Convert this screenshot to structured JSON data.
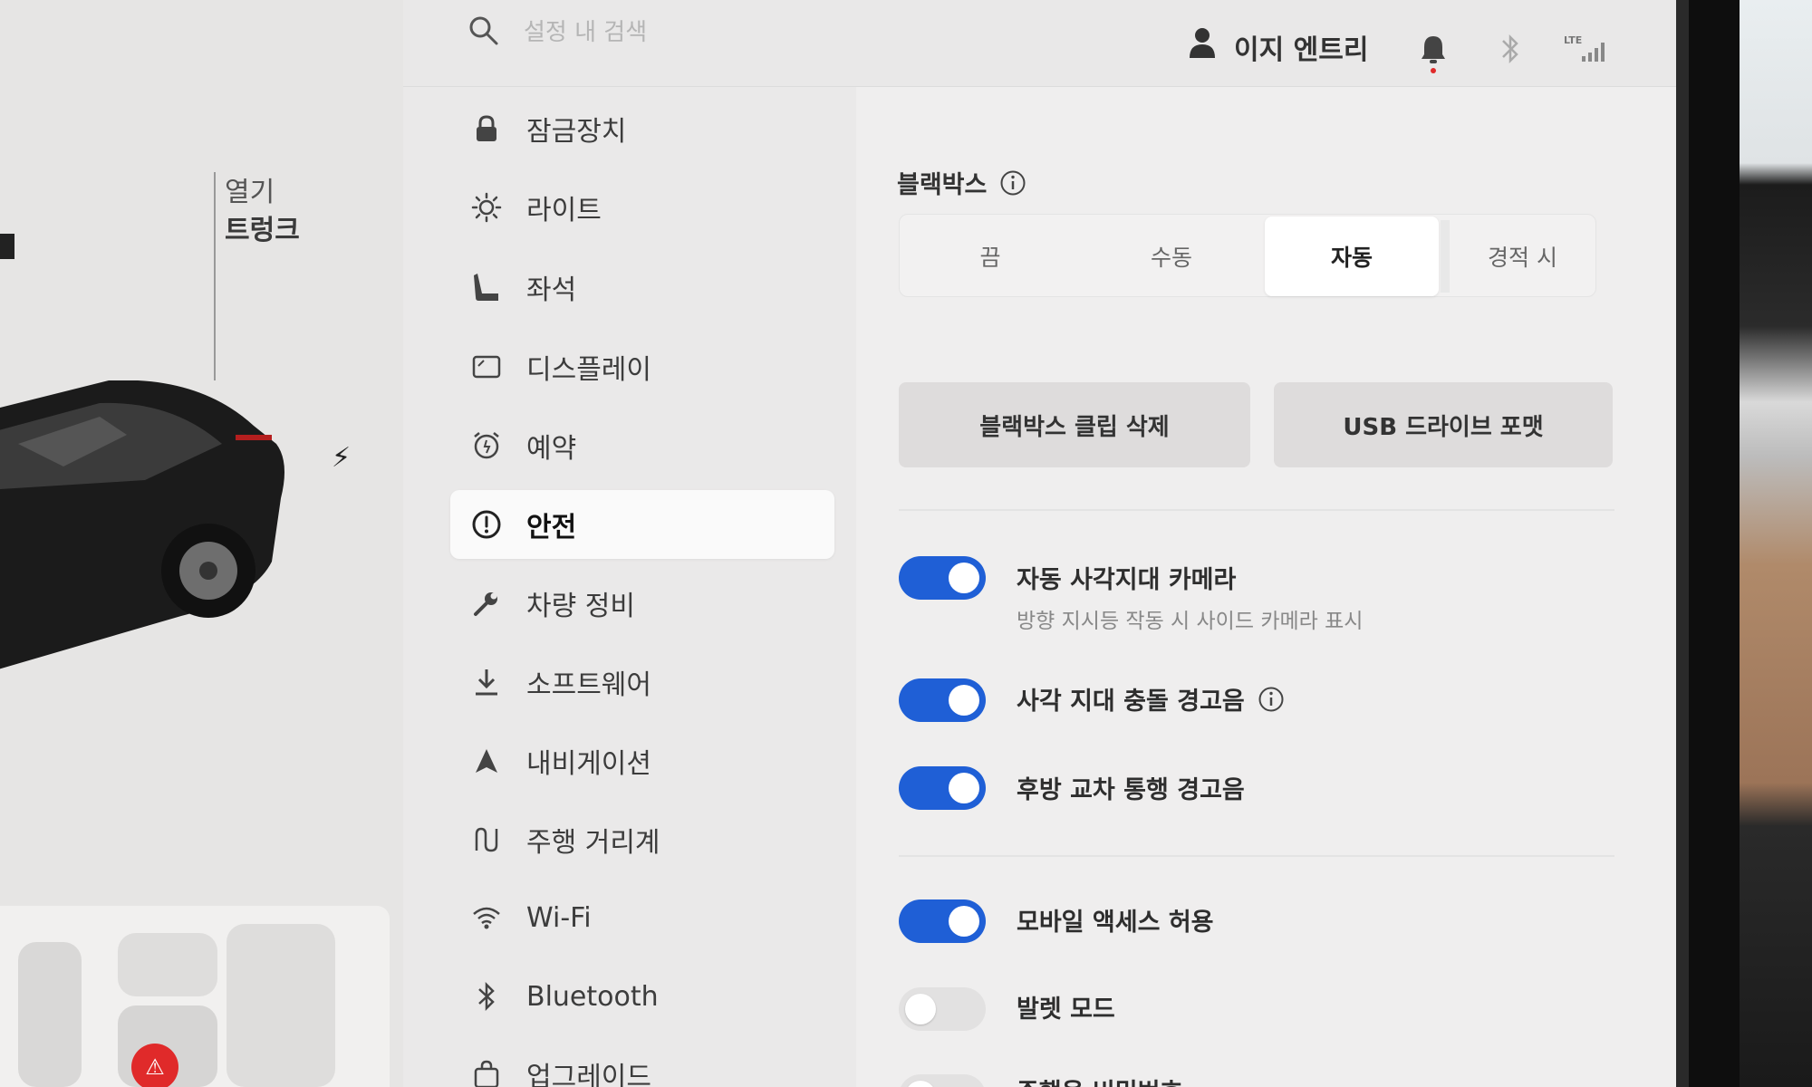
{
  "search": {
    "placeholder": "설정 내 검색"
  },
  "header": {
    "user_name": "이지 엔트리",
    "signal_label": "LTE"
  },
  "car_panel": {
    "open_label": "열기",
    "trunk_label": "트렁크"
  },
  "menu": {
    "items": [
      {
        "label": "잠금장치",
        "icon": "lock-icon"
      },
      {
        "label": "라이트",
        "icon": "light-icon"
      },
      {
        "label": "좌석",
        "icon": "seat-icon"
      },
      {
        "label": "디스플레이",
        "icon": "display-icon"
      },
      {
        "label": "예약",
        "icon": "alarm-clock-icon"
      },
      {
        "label": "안전",
        "icon": "alert-circle-icon",
        "active": true
      },
      {
        "label": "차량 정비",
        "icon": "wrench-icon"
      },
      {
        "label": "소프트웨어",
        "icon": "download-icon"
      },
      {
        "label": "내비게이션",
        "icon": "navigation-arrow-icon"
      },
      {
        "label": "주행 거리계",
        "icon": "trip-icon"
      },
      {
        "label": "Wi-Fi",
        "icon": "wifi-icon"
      },
      {
        "label": "Bluetooth",
        "icon": "bluetooth-icon"
      },
      {
        "label": "업그레이드",
        "icon": "shopping-bag-icon"
      }
    ]
  },
  "dashcam": {
    "title": "블랙박스",
    "options": [
      "끔",
      "수동",
      "자동",
      "경적 시"
    ],
    "selected": "자동"
  },
  "actions": {
    "delete_clips": "블랙박스 클립 삭제",
    "format_usb": "USB 드라이브 포맷"
  },
  "toggles": [
    {
      "label": "자동 사각지대 카메라",
      "sub": "방향 지시등 작동 시 사이드 카메라 표시",
      "on": true
    },
    {
      "label": "사각 지대 충돌 경고음",
      "info": true,
      "on": true
    },
    {
      "label": "후방 교차 통행 경고음",
      "on": true
    },
    {
      "label": "모바일 액세스 허용",
      "on": true
    },
    {
      "label": "발렛 모드",
      "on": false
    },
    {
      "label": "주행용 비밀번호",
      "on": false
    }
  ],
  "colors": {
    "accent": "#1f5fd6",
    "alert": "#e02a2a"
  }
}
